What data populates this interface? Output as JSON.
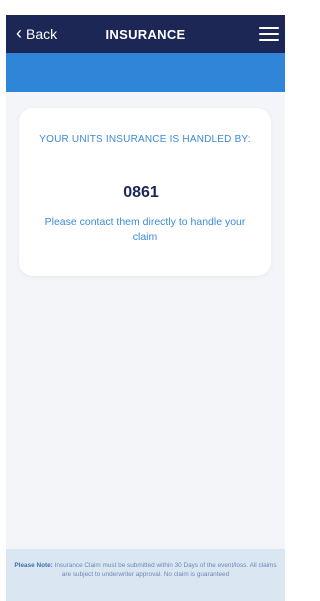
{
  "nav": {
    "back_label": "Back",
    "title": "INSURANCE",
    "menu_icon": "hamburger-menu-icon"
  },
  "card": {
    "heading": "YOUR UNITS INSURANCE IS HANDLED BY:",
    "number": "0861",
    "message": "Please contact them directly to handle your claim"
  },
  "footer": {
    "note_label": "Please Note:",
    "note_text": " Insurance Claim must be submitted within 30 Days of the event/loss. All claims are subject to underwriter approval. No claim is guaranteed"
  },
  "colors": {
    "navbar": "#1c2756",
    "banner": "#2f86d8",
    "accent_text": "#3a8bd6",
    "footer_bg": "#dbe6f3"
  }
}
